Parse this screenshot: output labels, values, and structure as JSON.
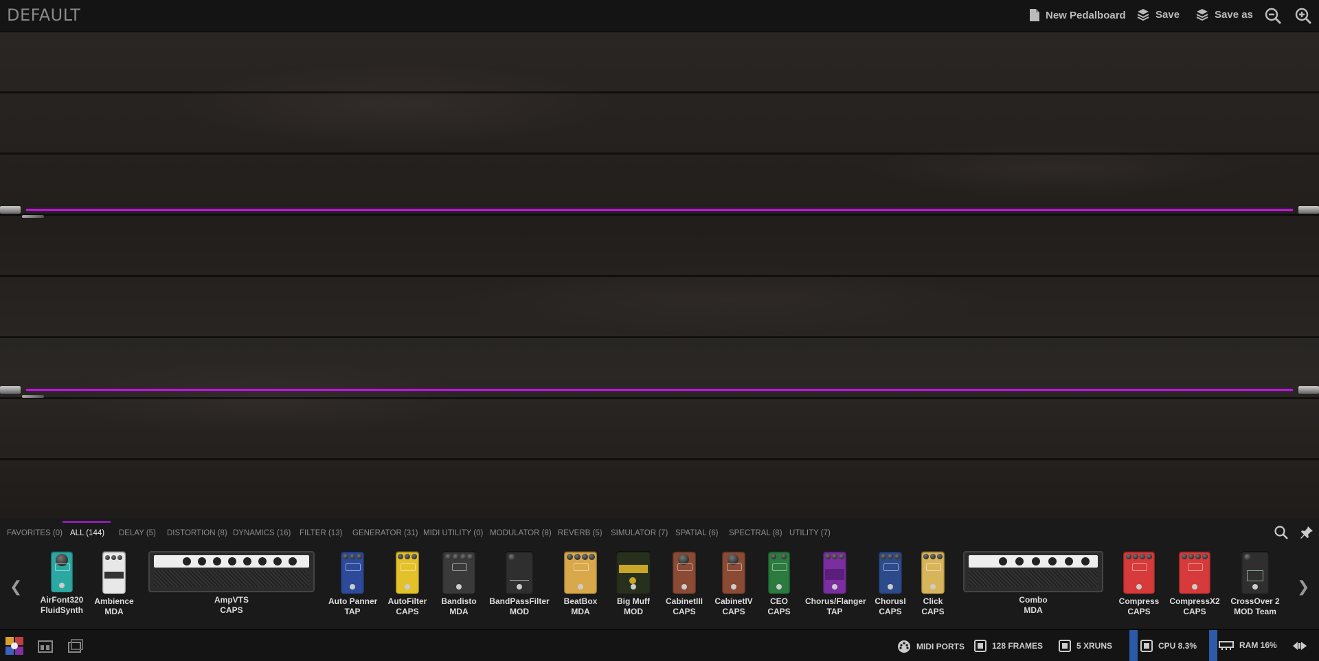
{
  "header": {
    "title": "DEFAULT",
    "new_pedalboard": "New Pedalboard",
    "save": "Save",
    "save_as": "Save as"
  },
  "tabs": [
    {
      "label": "FAVORITES (0)"
    },
    {
      "label": "ALL (144)",
      "active": true
    },
    {
      "label": "DELAY (5)"
    },
    {
      "label": "DISTORTION (8)"
    },
    {
      "label": "DYNAMICS (16)"
    },
    {
      "label": "FILTER (13)"
    },
    {
      "label": "GENERATOR (31)"
    },
    {
      "label": "MIDI UTILITY (0)"
    },
    {
      "label": "MODULATOR (8)"
    },
    {
      "label": "REVERB (5)"
    },
    {
      "label": "SIMULATOR (7)"
    },
    {
      "label": "SPATIAL (6)"
    },
    {
      "label": "SPECTRAL (8)"
    },
    {
      "label": "UTILITY (7)"
    }
  ],
  "plugins": [
    {
      "name": "AirFont320",
      "author": "FluidSynth",
      "color": "#2aa9a2"
    },
    {
      "name": "Ambience",
      "author": "MDA",
      "color": "#e8e8e8"
    },
    {
      "name": "AmpVTS",
      "author": "CAPS",
      "color": "#2b2b2b"
    },
    {
      "name": "Auto Panner",
      "author": "TAP",
      "color": "#2d4a9a"
    },
    {
      "name": "AutoFilter",
      "author": "CAPS",
      "color": "#e3c12a"
    },
    {
      "name": "Bandisto",
      "author": "MDA",
      "color": "#3a3a3a"
    },
    {
      "name": "BandPassFilter",
      "author": "MOD",
      "color": "#2f2f2f"
    },
    {
      "name": "BeatBox",
      "author": "MDA",
      "color": "#d8a84a"
    },
    {
      "name": "Big Muff",
      "author": "MOD",
      "color": "#27301d"
    },
    {
      "name": "CabinetIII",
      "author": "CAPS",
      "color": "#8a4a34"
    },
    {
      "name": "CabinetIV",
      "author": "CAPS",
      "color": "#8a4a34"
    },
    {
      "name": "CEO",
      "author": "CAPS",
      "color": "#2b7a3e"
    },
    {
      "name": "Chorus/Flanger",
      "author": "TAP",
      "color": "#7a2ea0"
    },
    {
      "name": "ChorusI",
      "author": "CAPS",
      "color": "#2d4a8a"
    },
    {
      "name": "Click",
      "author": "CAPS",
      "color": "#d8b45a"
    },
    {
      "name": "Combo",
      "author": "MDA",
      "color": "#2b2b2b"
    },
    {
      "name": "Compress",
      "author": "CAPS",
      "color": "#d63a3a"
    },
    {
      "name": "CompressX2",
      "author": "CAPS",
      "color": "#d63a3a"
    },
    {
      "name": "CrossOver 2",
      "author": "MOD Team",
      "color": "#2f2f2f"
    }
  ],
  "status": {
    "midi_ports": "MIDI PORTS",
    "frames": "128 FRAMES",
    "xruns": "5 XRUNS",
    "cpu": "CPU 8.3%",
    "ram": "RAM 16%"
  },
  "colors": {
    "cable": "#b21dc9",
    "tab_active_underline": "#8a1fb0",
    "meter": "#2a5aa8"
  }
}
